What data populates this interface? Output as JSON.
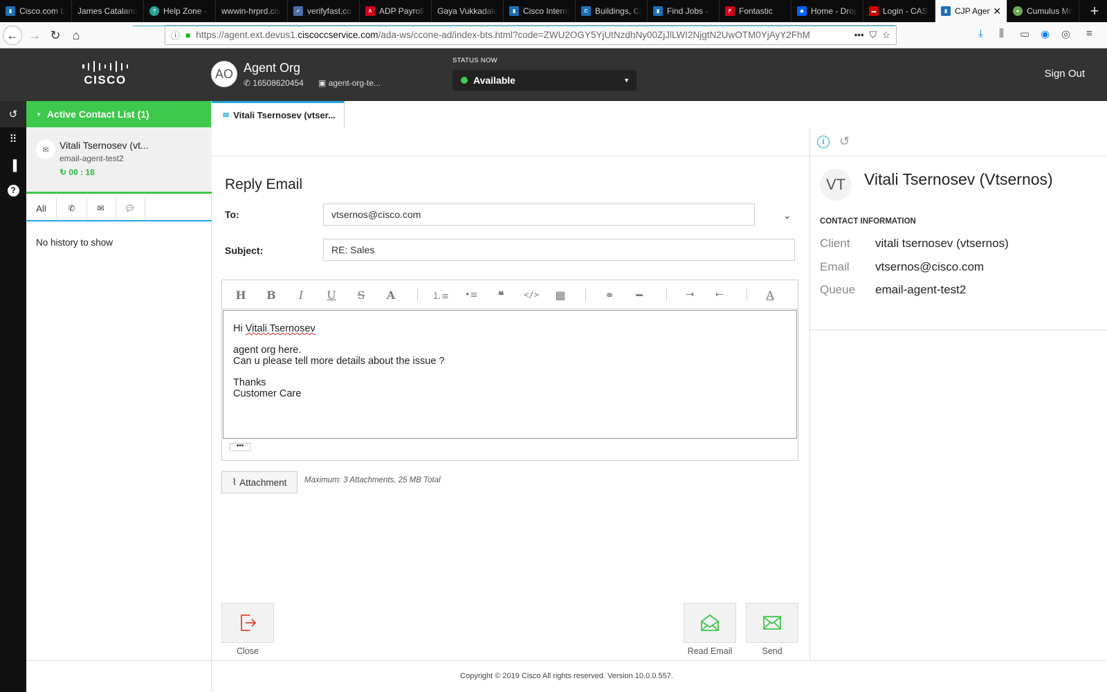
{
  "browser": {
    "tabs": [
      {
        "label": "Cisco.com Lo",
        "color": "#1d6fb8",
        "active": false
      },
      {
        "label": "James Catalano",
        "color": "",
        "active": false
      },
      {
        "label": "Help Zone -",
        "color": "#2aa198",
        "active": false
      },
      {
        "label": "wwwin-hrprd.cisc",
        "color": "",
        "active": false
      },
      {
        "label": "verifyfast.co",
        "color": "#4a6ea9",
        "active": false
      },
      {
        "label": "ADP Payroll",
        "color": "#d0021b",
        "active": false
      },
      {
        "label": "Gaya Vukkadala",
        "color": "",
        "active": false
      },
      {
        "label": "Cisco Interna",
        "color": "#1d6fb8",
        "active": false
      },
      {
        "label": "Buildings, Co",
        "color": "#1d6fb8",
        "active": false
      },
      {
        "label": "Find Jobs -",
        "color": "#1d6fb8",
        "active": false
      },
      {
        "label": "Fontastic",
        "color": "#d0021b",
        "active": false
      },
      {
        "label": "Home - Drop",
        "color": "#0061fe",
        "active": false
      },
      {
        "label": "Login - CAS",
        "color": "#c00",
        "active": false
      },
      {
        "label": "CJP Agen",
        "color": "#1d6fb8",
        "active": true
      },
      {
        "label": "Cumulus Mo",
        "color": "#6aa84f",
        "active": false
      }
    ],
    "url_host_prefix": "https://agent.ext.devus1.",
    "url_host": "ciscoccservice.com",
    "url_path": "/ada-ws/ccone-ad/index-bts.html?code=ZWU2OGY5YjUtNzdhNy00ZjJlLWI2NjgtN2UwOTM0YjAyY2FhM"
  },
  "header": {
    "logo_text": "CISCO",
    "agent_initials": "AO",
    "agent_name": "Agent Org",
    "agent_phone": "16508620454",
    "agent_team": "agent-org-te...",
    "status_label": "STATUS NOW",
    "status_value": "Available",
    "status_color": "#3dce50",
    "sign_out": "Sign Out"
  },
  "contact_list": {
    "header": "Active Contact List (1)",
    "item_name": "Vitali Tsernosev (vt...",
    "item_queue": "email-agent-test2",
    "item_timer": "00 : 18",
    "history_tab_all": "All",
    "no_history": "No history to show"
  },
  "content_tab": {
    "label": "Vitali Tsernosev (vtser..."
  },
  "reply": {
    "title": "Reply Email",
    "to_label": "To:",
    "to_value": "vtsernos@cisco.com",
    "subject_label": "Subject:",
    "subject_value": "RE: Sales",
    "body_greeting_pre": "Hi ",
    "body_greeting_name": "Vitali Tsernosev",
    "body_line1": "agent org here.",
    "body_line2": "Can u please tell more details about the issue ?",
    "body_line3": "Thanks",
    "body_line4": "Customer Care",
    "more_btn": "•••",
    "attachment_btn": "Attachment",
    "attachment_note": "Maximum: 3 Attachments, 25 MB Total",
    "close_label": "Close",
    "read_email_label": "Read Email",
    "send_label": "Send"
  },
  "customer": {
    "initials": "VT",
    "name": "Vitali Tsernosev (Vtsernos)",
    "section_title": "CONTACT INFORMATION",
    "client_label": "Client",
    "client_value": "vitali tsernosev (vtsernos)",
    "email_label": "Email",
    "email_value": "vtsernos@cisco.com",
    "queue_label": "Queue",
    "queue_value": "email-agent-test2"
  },
  "footer": {
    "copyright": "Copyright © 2019 Cisco All rights reserved. Version 10.0.0.557."
  },
  "colors": {
    "accent_green": "#3dc94b",
    "accent_blue": "#25a8e0",
    "header_bg": "#333333"
  }
}
